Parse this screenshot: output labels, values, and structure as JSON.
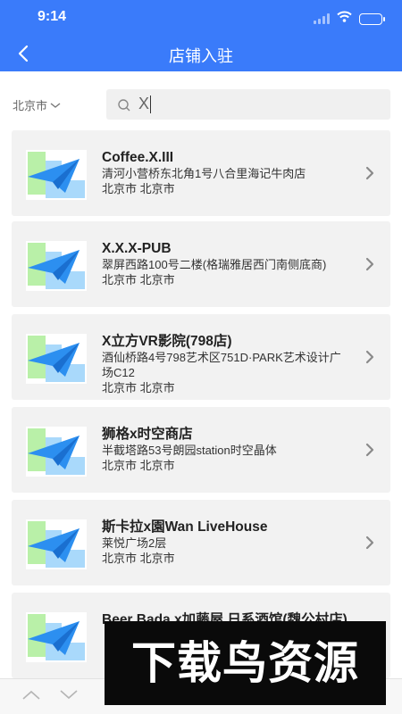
{
  "status_bar": {
    "time": "9:14",
    "icons": [
      "signal-icon",
      "wifi-icon",
      "battery-icon"
    ]
  },
  "nav": {
    "back_icon": "back-arrow-icon",
    "title": "店铺入驻"
  },
  "search": {
    "city": "北京市",
    "city_icon": "chevron-down-icon",
    "search_icon": "search-icon",
    "value": "X"
  },
  "stores": [
    {
      "name": "Coffee.X.III",
      "address": "清河小营桥东北角1号八合里海记牛肉店",
      "region": "北京市 北京市"
    },
    {
      "name": "X.X.X-PUB",
      "address": "翠屏西路100号二楼(格瑞雅居西门南侧底商)",
      "region": "北京市 北京市"
    },
    {
      "name": "X立方VR影院(798店)",
      "address": "酒仙桥路4号798艺术区751D·PARK艺术设计广场C12",
      "region": "北京市 北京市"
    },
    {
      "name": "狮格x时空商店",
      "address": "半截塔路53号朗园station时空晶体",
      "region": "北京市 北京市"
    },
    {
      "name": "斯卡拉x園Wan LiveHouse",
      "address": "莱悦广场2层",
      "region": "北京市 北京市"
    },
    {
      "name": "Beer Bada x加藤屋 日系酒馆(魏公村店)",
      "address": "",
      "region": ""
    }
  ],
  "toolbar": {
    "icons": [
      "chevron-up-icon",
      "chevron-down-icon"
    ]
  },
  "watermark": {
    "text": "下载鸟资源"
  },
  "colors": {
    "brand": "#3a7bfa",
    "card": "#f2f2f2",
    "thumb_green": "#b9f0a8",
    "thumb_blue": "#a9d9fb",
    "plane": "#2c8ff0"
  }
}
